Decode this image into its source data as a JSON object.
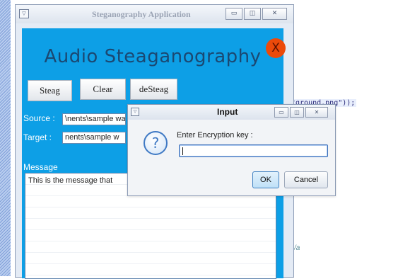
{
  "background": {
    "code_snippet": "tground.png\"));",
    "side_text": "/a"
  },
  "main_window": {
    "title": "Steganography Application",
    "app_title": "Audio Steaganography",
    "close_glyph": "X",
    "buttons": {
      "steag": "Steag",
      "clear": "Clear",
      "desteag": "deSteag"
    },
    "source": {
      "label": "Source :",
      "value": "\\nents\\sample wa"
    },
    "target": {
      "label": "Target :",
      "value": "nents\\sample w"
    },
    "message": {
      "label": "Message",
      "text": "This is the message that"
    },
    "colors": {
      "panel": "#0d9fe6",
      "title_text": "#1b4872",
      "close_button": "#ec4a0a"
    }
  },
  "dialog": {
    "title": "Input",
    "icon": "question-icon",
    "prompt": "Enter Encryption key :",
    "input_value": "",
    "ok_label": "OK",
    "cancel_label": "Cancel"
  }
}
